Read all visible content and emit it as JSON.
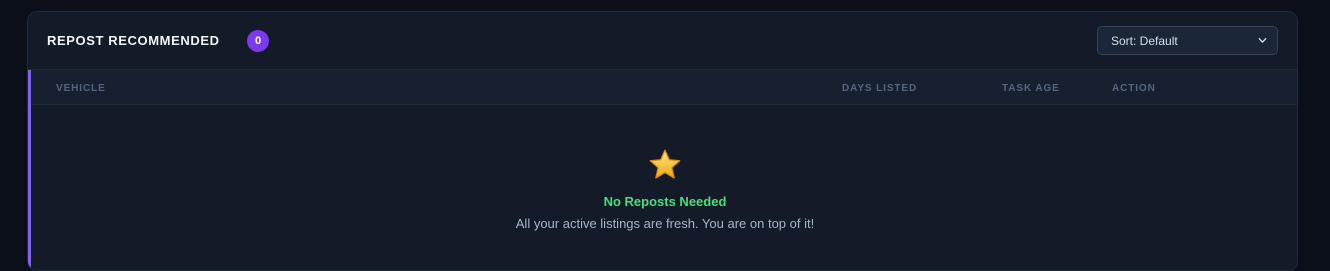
{
  "header": {
    "title": "REPOST RECOMMENDED",
    "count": "0",
    "sort_label": "Sort: Default",
    "accent_color": "#7c3aed"
  },
  "table": {
    "columns": [
      "VEHICLE",
      "DAYS LISTED",
      "TASK AGE",
      "ACTION"
    ],
    "accent_color": "#8b5cf6"
  },
  "empty_state": {
    "icon": "star-icon",
    "title": "No Reposts Needed",
    "message": "All your active listings are fresh. You are on top of it!",
    "title_color": "#4ade80"
  }
}
